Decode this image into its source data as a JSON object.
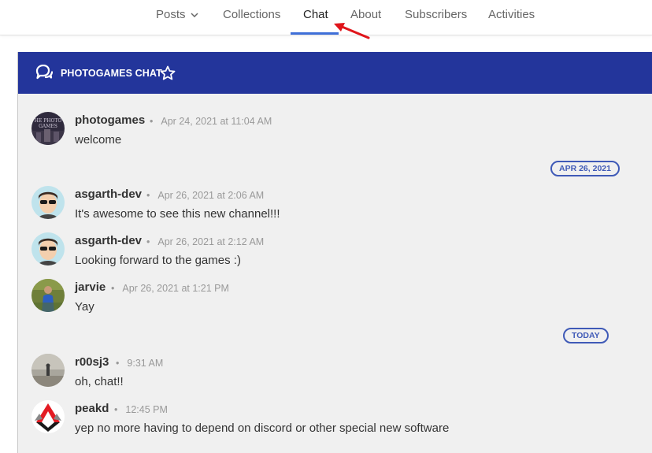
{
  "nav": {
    "tabs": [
      "Posts",
      "Collections",
      "Chat",
      "About",
      "Subscribers",
      "Activities"
    ],
    "active": "Chat"
  },
  "channel": {
    "title": "PHOTOGAMES CHAT"
  },
  "separators": [
    "APR 26, 2021",
    "TODAY"
  ],
  "messages": [
    {
      "author": "photogames",
      "time": "Apr 24, 2021 at 11:04 AM",
      "text": "welcome"
    },
    {
      "author": "asgarth-dev",
      "time": "Apr 26, 2021 at 2:06 AM",
      "text": "It's awesome to see this new channel!!!"
    },
    {
      "author": "asgarth-dev",
      "time": "Apr 26, 2021 at 2:12 AM",
      "text": "Looking forward to the games :)"
    },
    {
      "author": "jarvie",
      "time": "Apr 26, 2021 at 1:21 PM",
      "text": "Yay"
    },
    {
      "author": "r00sj3",
      "time": "9:31 AM",
      "text": "oh, chat!!"
    },
    {
      "author": "peakd",
      "time": "12:45 PM",
      "text": "yep no more having to depend on discord or other special new software"
    }
  ],
  "colors": {
    "header": "#23359b",
    "accent": "#3f6fd8",
    "annotation": "#e0151b"
  },
  "icons": {
    "chevron": "chevron-down-icon",
    "chat": "chat-bubbles-icon",
    "star": "star-outline-icon",
    "arrow": "red-arrow-icon"
  }
}
